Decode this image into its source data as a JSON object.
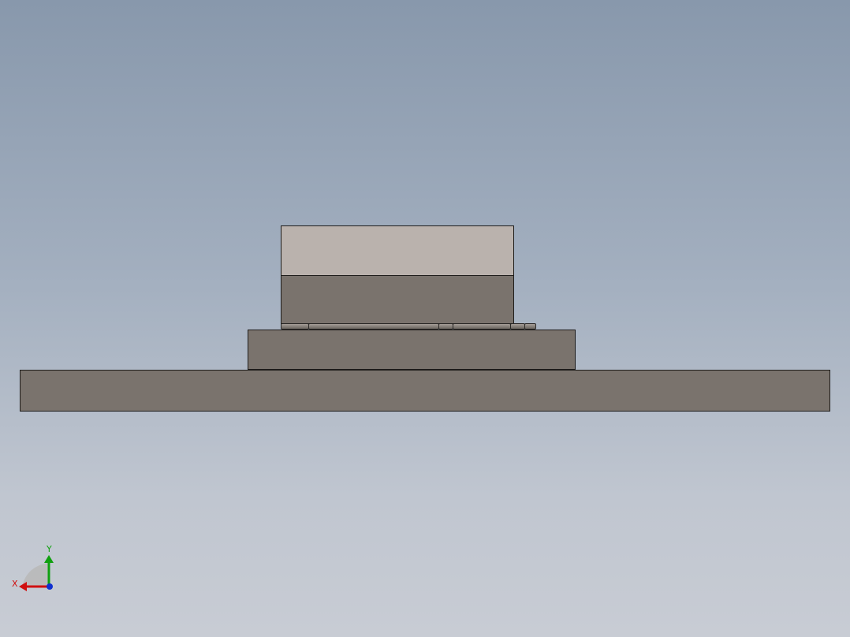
{
  "viewport": {
    "background_top": "#8898ac",
    "background_bottom": "#c8ccd4"
  },
  "model": {
    "top_cap_color": "#bab2ad",
    "body_color": "#7a736d",
    "edge_color": "#1e1c1a"
  },
  "triad": {
    "x_label": "X",
    "y_label": "Y",
    "x_color": "#d01010",
    "y_color": "#10a010",
    "z_color": "#1030d0"
  }
}
